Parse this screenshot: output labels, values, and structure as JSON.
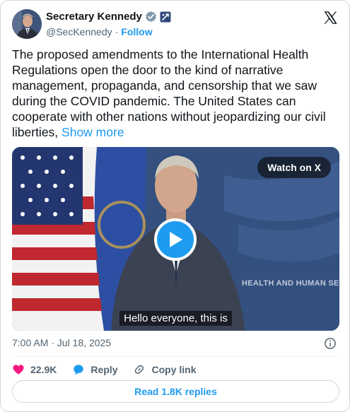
{
  "header": {
    "display_name": "Secretary Kennedy",
    "handle": "@SecKennedy",
    "separator": "·",
    "follow_label": "Follow"
  },
  "tweet": {
    "text": "The proposed amendments to the International Health Regulations open the door to the kind of narrative management, propaganda, and censorship that we saw during the COVID pandemic. The United States can cooperate with other nations without jeopardizing our civil liberties,",
    "show_more_label": "Show more"
  },
  "video": {
    "watch_label": "Watch on X",
    "caption": "Hello everyone, this is",
    "wall_text": "HEALTH AND HUMAN SERVI"
  },
  "meta": {
    "timestamp": "7:00 AM · Jul 18, 2025"
  },
  "actions": {
    "like_count": "22.9K",
    "reply_label": "Reply",
    "copy_link_label": "Copy link"
  },
  "replies_button_label": "Read 1.8K replies",
  "colors": {
    "accent": "#1d9bf0",
    "like": "#f91880",
    "text": "#0f1419",
    "secondary": "#536471"
  },
  "icons": [
    "verified-badge-icon",
    "government-badge-icon",
    "x-logo-icon",
    "play-icon",
    "info-icon",
    "heart-icon",
    "reply-bubble-icon",
    "link-icon"
  ]
}
